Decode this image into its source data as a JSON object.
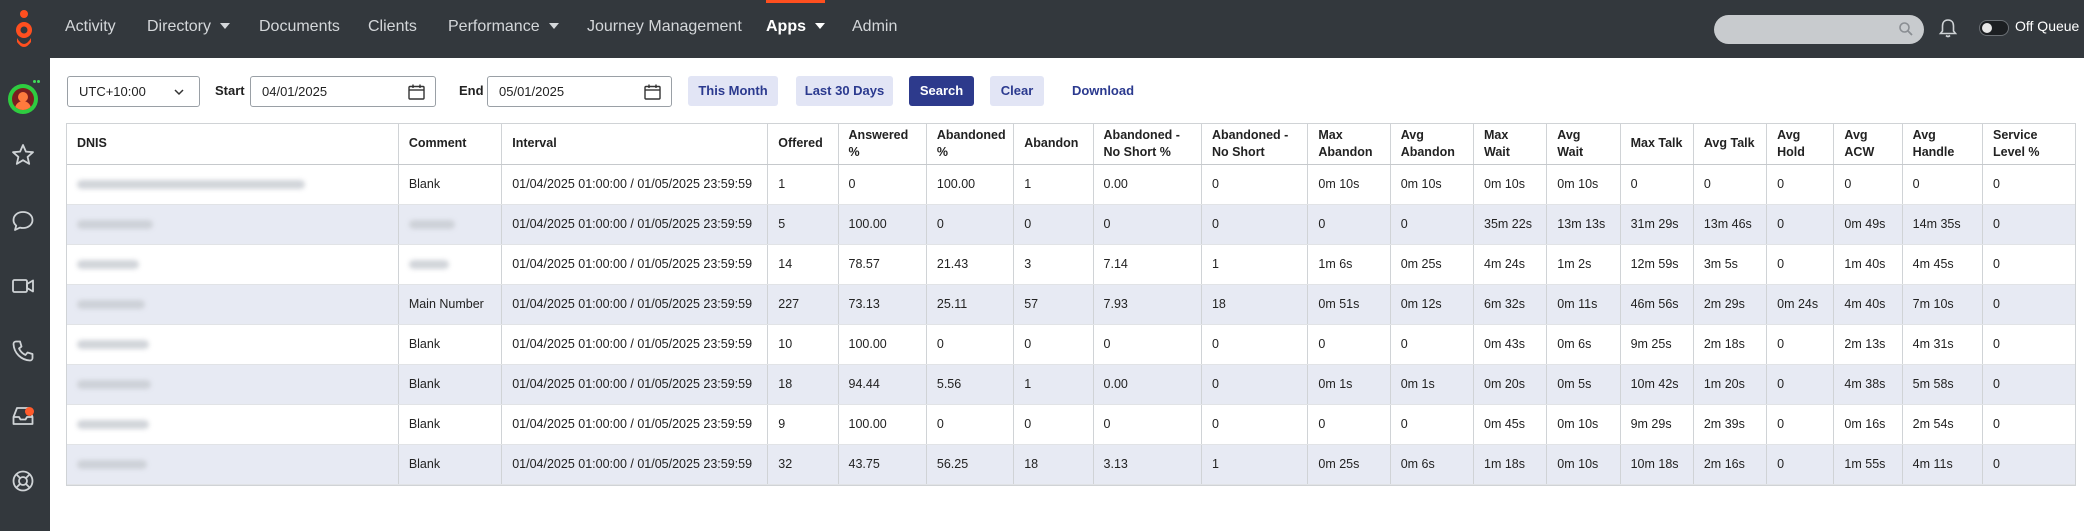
{
  "nav": {
    "items": [
      {
        "label": "Activity",
        "caret": false,
        "active": false
      },
      {
        "label": "Directory",
        "caret": true,
        "active": false
      },
      {
        "label": "Documents",
        "caret": false,
        "active": false
      },
      {
        "label": "Clients",
        "caret": false,
        "active": false
      },
      {
        "label": "Performance",
        "caret": true,
        "active": false
      },
      {
        "label": "Journey Management",
        "caret": false,
        "active": false
      },
      {
        "label": "Apps",
        "caret": true,
        "active": true
      },
      {
        "label": "Admin",
        "caret": false,
        "active": false
      }
    ],
    "queue_label": "Off Queue",
    "accent": "#ff4f1f"
  },
  "sidebar": {
    "icons": [
      "avatar",
      "star-icon",
      "chat-icon",
      "video-icon",
      "phone-icon",
      "inbox-icon",
      "help-icon"
    ]
  },
  "filters": {
    "timezone": "UTC+10:00",
    "start_label": "Start",
    "start_value": "04/01/2025",
    "end_label": "End",
    "end_value": "05/01/2025",
    "this_month": "This Month",
    "last_30_days": "Last 30 Days",
    "search": "Search",
    "clear": "Clear",
    "download": "Download"
  },
  "table": {
    "headers": [
      "DNIS",
      "Comment",
      "Interval",
      "Offered",
      "Answered %",
      "Abandoned %",
      "Abandon",
      "Abandoned - No Short %",
      "Abandoned - No Short",
      "Max Abandon",
      "Avg Abandon",
      "Max Wait",
      "Avg Wait",
      "Max Talk",
      "Avg Talk",
      "Avg Hold",
      "Avg ACW",
      "Avg Handle",
      "Service Level %"
    ],
    "rows": [
      {
        "dnis": "",
        "cells": [
          "Blank",
          "01/04/2025 01:00:00 / 01/05/2025 23:59:59",
          "1",
          "0",
          "100.00",
          "1",
          "0.00",
          "0",
          "0m 10s",
          "0m 10s",
          "0m 10s",
          "0m 10s",
          "0",
          "0",
          "0",
          "0",
          "0",
          "0"
        ]
      },
      {
        "dnis": "",
        "cells": [
          "",
          "01/04/2025 01:00:00 / 01/05/2025 23:59:59",
          "5",
          "100.00",
          "0",
          "0",
          "0",
          "0",
          "0",
          "0",
          "35m 22s",
          "13m 13s",
          "31m 29s",
          "13m 46s",
          "0",
          "0m 49s",
          "14m 35s",
          "0"
        ]
      },
      {
        "dnis": "",
        "cells": [
          "",
          "01/04/2025 01:00:00 / 01/05/2025 23:59:59",
          "14",
          "78.57",
          "21.43",
          "3",
          "7.14",
          "1",
          "1m 6s",
          "0m 25s",
          "4m 24s",
          "1m 2s",
          "12m 59s",
          "3m 5s",
          "0",
          "1m 40s",
          "4m 45s",
          "0"
        ]
      },
      {
        "dnis": "",
        "cells": [
          "Main Number",
          "01/04/2025 01:00:00 / 01/05/2025 23:59:59",
          "227",
          "73.13",
          "25.11",
          "57",
          "7.93",
          "18",
          "0m 51s",
          "0m 12s",
          "6m 32s",
          "0m 11s",
          "46m 56s",
          "2m 29s",
          "0m 24s",
          "4m 40s",
          "7m 10s",
          "0"
        ]
      },
      {
        "dnis": "",
        "cells": [
          "Blank",
          "01/04/2025 01:00:00 / 01/05/2025 23:59:59",
          "10",
          "100.00",
          "0",
          "0",
          "0",
          "0",
          "0",
          "0",
          "0m 43s",
          "0m 6s",
          "9m 25s",
          "2m 18s",
          "0",
          "2m 13s",
          "4m 31s",
          "0"
        ]
      },
      {
        "dnis": "",
        "cells": [
          "Blank",
          "01/04/2025 01:00:00 / 01/05/2025 23:59:59",
          "18",
          "94.44",
          "5.56",
          "1",
          "0.00",
          "0",
          "0m 1s",
          "0m 1s",
          "0m 20s",
          "0m 5s",
          "10m 42s",
          "1m 20s",
          "0",
          "4m 38s",
          "5m 58s",
          "0"
        ]
      },
      {
        "dnis": "",
        "cells": [
          "Blank",
          "01/04/2025 01:00:00 / 01/05/2025 23:59:59",
          "9",
          "100.00",
          "0",
          "0",
          "0",
          "0",
          "0",
          "0",
          "0m 45s",
          "0m 10s",
          "9m 29s",
          "2m 39s",
          "0",
          "0m 16s",
          "2m 54s",
          "0"
        ]
      },
      {
        "dnis": "",
        "cells": [
          "Blank",
          "01/04/2025 01:00:00 / 01/05/2025 23:59:59",
          "32",
          "43.75",
          "56.25",
          "18",
          "3.13",
          "1",
          "0m 25s",
          "0m 6s",
          "1m 18s",
          "0m 10s",
          "10m 18s",
          "2m 16s",
          "0",
          "1m 55s",
          "4m 11s",
          "0"
        ]
      }
    ]
  }
}
